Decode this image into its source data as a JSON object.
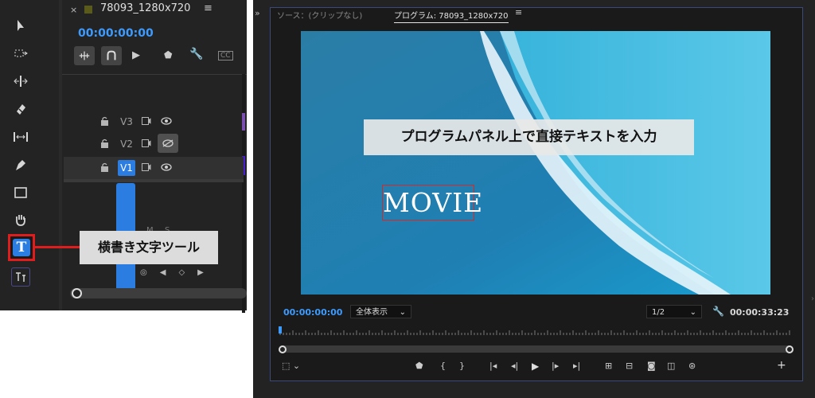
{
  "timeline": {
    "sequence_name": "78093_1280x720",
    "timecode": "00:00:00:00",
    "tracks": [
      {
        "name": "V3"
      },
      {
        "name": "V2"
      },
      {
        "name": "V1"
      }
    ],
    "audio_m": "M",
    "audio_s": "S"
  },
  "annotations": {
    "type_tool_label": "横書き文字ツール",
    "program_caption": "プログラムパネル上で直接テキストを入力"
  },
  "monitor": {
    "source_tab": "ソース：(クリップなし)",
    "program_tab": "プログラム: 78093_1280x720",
    "title_text": "MOVIE",
    "current_timecode": "00:00:00:00",
    "fit_value": "全体表示",
    "resolution_value": "1/2",
    "duration": "00:00:33:23"
  },
  "colors": {
    "accent_blue": "#2b7de1",
    "timecode_blue": "#3d9bff",
    "highlight_red": "#e01d1d"
  }
}
